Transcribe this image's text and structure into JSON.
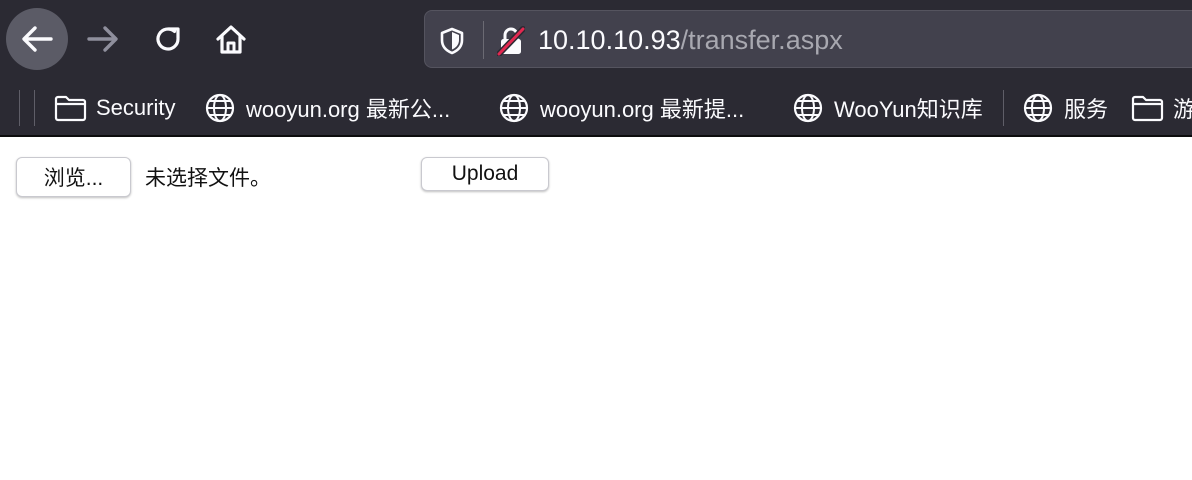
{
  "browser": {
    "url_host": "10.10.10.93",
    "url_path": "/transfer.aspx",
    "bookmarks": [
      {
        "label": "Security",
        "icon": "folder-icon"
      },
      {
        "label": "wooyun.org 最新公...",
        "icon": "globe-icon"
      },
      {
        "label": "wooyun.org 最新提...",
        "icon": "globe-icon"
      },
      {
        "label": "WooYun知识库",
        "icon": "globe-icon"
      },
      {
        "label": "服务",
        "icon": "globe-icon"
      },
      {
        "label": "游",
        "icon": "folder-icon"
      }
    ],
    "colors": {
      "toolbar_bg": "#2b2a33",
      "urlbar_bg": "#42414d",
      "insecure_lock": "#e22850"
    }
  },
  "page": {
    "browse_label": "浏览...",
    "file_status": "未选择文件。",
    "upload_label": "Upload"
  }
}
